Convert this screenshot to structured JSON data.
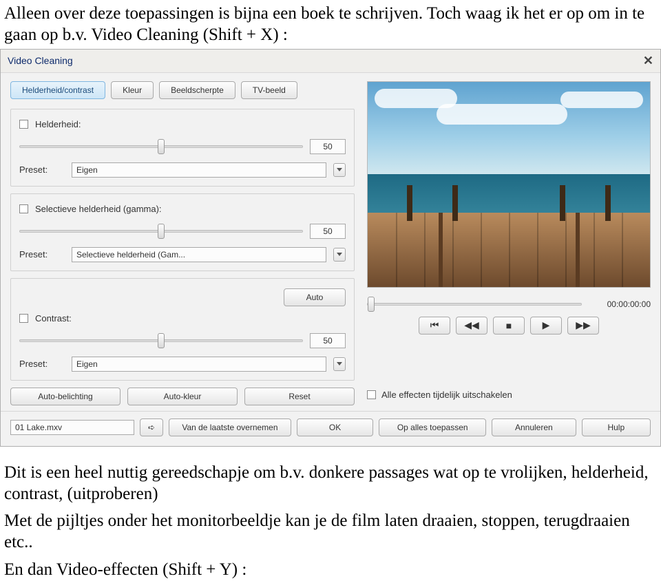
{
  "doc": {
    "para1": "Alleen over deze toepassingen is bijna een boek te schrijven. Toch waag ik het er op om in te gaan op b.v. Video Cleaning (Shift + X) :",
    "para2": "Dit is een heel nuttig gereedschapje om b.v. donkere passages wat op te vrolijken, helderheid, contrast, (uitproberen)",
    "para3": "Met de pijltjes onder het monitorbeeldje kan je de film laten draaien, stoppen, terugdraaien etc..",
    "para4": "En dan Video-effecten (Shift + Y) :"
  },
  "window": {
    "title": "Video Cleaning",
    "tabs": [
      "Helderheid/contrast",
      "Kleur",
      "Beeldscherpte",
      "TV-beeld"
    ],
    "brightness": {
      "label": "Helderheid:",
      "value": "50",
      "preset_label": "Preset:",
      "preset_value": "Eigen"
    },
    "gamma": {
      "label": "Selectieve helderheid (gamma):",
      "value": "50",
      "preset_label": "Preset:",
      "preset_value": "Selectieve helderheid (Gam..."
    },
    "contrast": {
      "label": "Contrast:",
      "auto_label": "Auto",
      "value": "50",
      "preset_label": "Preset:",
      "preset_value": "Eigen"
    },
    "actions": {
      "auto_exposure": "Auto-belichting",
      "auto_color": "Auto-kleur",
      "reset": "Reset"
    },
    "disable_fx": "Alle effecten tijdelijk uitschakelen",
    "footer": {
      "file": "01 Lake.mxv",
      "from_last": "Van de laatste overnemen",
      "ok": "OK",
      "apply_all": "Op alles toepassen",
      "cancel": "Annuleren",
      "help": "Hulp"
    },
    "timecode": "00:00:00:00"
  }
}
